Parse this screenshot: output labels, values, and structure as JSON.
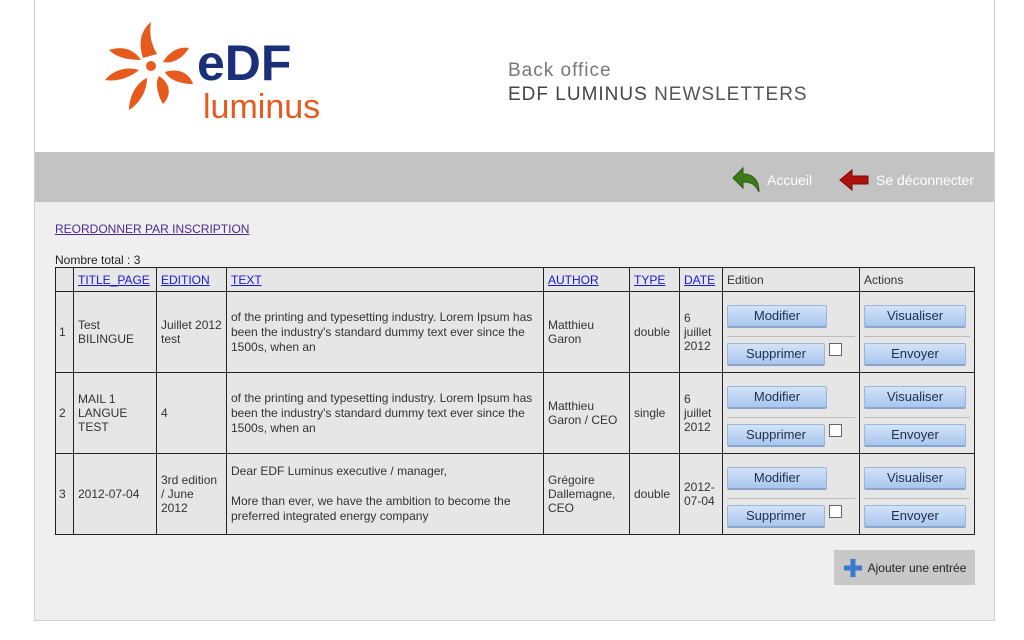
{
  "header": {
    "logo_text_top": "eDF",
    "logo_text_bottom": "luminus",
    "title": "Back office",
    "subtitle_bold": "EDF LUMINUS",
    "subtitle_rest": "NEWSLETTERS"
  },
  "nav": {
    "home_label": "Accueil",
    "logout_label": "Se déconnecter"
  },
  "main": {
    "reorder_link": "REORDONNER PAR INSCRIPTION",
    "total_label": "Nombre total : 3"
  },
  "table": {
    "headers": {
      "num": "",
      "title_page": "TITLE_PAGE",
      "edition": "EDITION",
      "text": "TEXT",
      "author": "AUTHOR",
      "type": "TYPE",
      "date": "DATE",
      "edition_col": "Edition",
      "actions": "Actions"
    },
    "buttons": {
      "modify": "Modifier",
      "delete": "Supprimer",
      "view": "Visualiser",
      "send": "Envoyer"
    },
    "rows": [
      {
        "num": "1",
        "title_page": "Test BILINGUE",
        "edition": "Juillet 2012 test",
        "text": "of the printing and typesetting industry. Lorem Ipsum has been the industry's standard dummy text ever since the 1500s, when an",
        "author": "Matthieu Garon",
        "type": "double",
        "date": "6 juillet 2012"
      },
      {
        "num": "2",
        "title_page": "MAIL 1 LANGUE TEST",
        "edition": "4",
        "text": "of the printing and typesetting industry. Lorem Ipsum has been the industry's standard dummy text ever since the 1500s, when an",
        "author": "Matthieu Garon / CEO",
        "type": "single",
        "date": "6 juillet 2012"
      },
      {
        "num": "3",
        "title_page": "2012-07-04",
        "edition": "3rd edition / June 2012",
        "text_line1": "Dear EDF Luminus executive / manager,",
        "text_line2": "More than ever, we have the ambition to become the preferred integrated energy company",
        "author": "Grégoire Dallemagne, CEO",
        "type": "double",
        "date": "2012-07-04"
      }
    ]
  },
  "add_button": {
    "label": "Ajouter une entrée"
  },
  "colors": {
    "brand_orange": "#e65a1e",
    "brand_navy": "#1a2f78",
    "nav_bar": "#c3c3c3",
    "button_blue": "#b8d0f2"
  }
}
